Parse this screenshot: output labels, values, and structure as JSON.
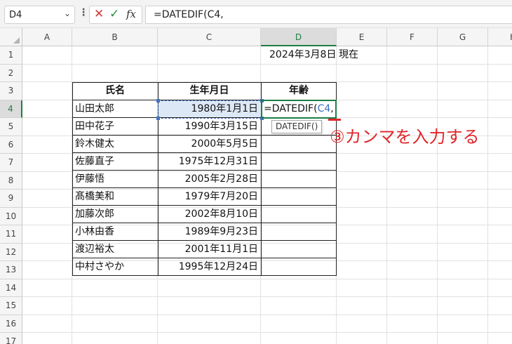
{
  "formula_bar": {
    "name_box": "D4",
    "name_box_arrow": "⌄",
    "dots": "⋮",
    "cancel_icon": "✕",
    "enter_icon": "✓",
    "fx_label": "fx",
    "formula": "=DATEDIF(C4,"
  },
  "columns": [
    "A",
    "B",
    "C",
    "D",
    "E",
    "F",
    "G",
    "H"
  ],
  "rows": [
    "1",
    "2",
    "3",
    "4",
    "5",
    "6",
    "7",
    "8",
    "9",
    "10",
    "11",
    "12",
    "13",
    "14",
    "15",
    "16",
    "17"
  ],
  "cells": {
    "d1": "2024年3月8日",
    "e1": "現在"
  },
  "table": {
    "headers": [
      "氏名",
      "生年月日",
      "年齢"
    ],
    "rows": [
      {
        "name": "山田太郎",
        "birth": "1980年1月1日"
      },
      {
        "name": "田中花子",
        "birth": "1990年3月15日"
      },
      {
        "name": "鈴木健太",
        "birth": "2000年5月5日"
      },
      {
        "name": "佐藤直子",
        "birth": "1975年12月31日"
      },
      {
        "name": "伊藤悟",
        "birth": "2005年2月28日"
      },
      {
        "name": "髙橋美和",
        "birth": "1979年7月20日"
      },
      {
        "name": "加藤次郎",
        "birth": "2002年8月10日"
      },
      {
        "name": "小林由香",
        "birth": "1989年9月23日"
      },
      {
        "name": "渡辺裕太",
        "birth": "2001年11月1日"
      },
      {
        "name": "中村さやか",
        "birth": "1995年12月24日"
      }
    ]
  },
  "editing": {
    "prefix": "=DATEDIF(",
    "ref": "C4",
    "suffix": ",",
    "tooltip": "DATEDIF()"
  },
  "annotation": "③カンマを入力する",
  "colors": {
    "selection_green": "#1e7e45",
    "reference_blue": "#4472c4",
    "annotation_red": "#e0262b"
  }
}
